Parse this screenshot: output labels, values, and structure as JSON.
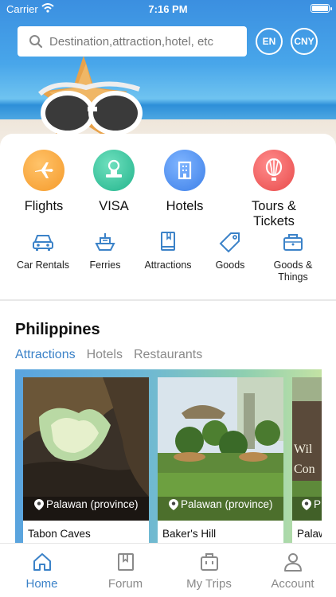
{
  "status_bar": {
    "carrier": "Carrier",
    "time": "7:16 PM"
  },
  "search": {
    "placeholder": "Destination,attraction,hotel, etc"
  },
  "header_buttons": {
    "language": "EN",
    "currency": "CNY"
  },
  "main_categories": [
    {
      "label": "Flights",
      "icon": "airplane-icon",
      "color": "#f7a43a"
    },
    {
      "label": "VISA",
      "icon": "visa-stamp-icon",
      "color": "#3cc3a0"
    },
    {
      "label": "Hotels",
      "icon": "building-icon",
      "color": "#4a8ff0"
    },
    {
      "label": "Tours & Tickets",
      "icon": "balloon-icon",
      "color": "#f05d5d"
    }
  ],
  "sub_categories": [
    {
      "label": "Car Rentals",
      "icon": "car-icon"
    },
    {
      "label": "Ferries",
      "icon": "ship-icon"
    },
    {
      "label": "Attractions",
      "icon": "book-icon"
    },
    {
      "label": "Goods",
      "icon": "tag-icon"
    },
    {
      "label": "Goods & Things",
      "icon": "basket-icon"
    }
  ],
  "region": {
    "title": "Philippines",
    "tabs": [
      "Attractions",
      "Hotels",
      "Restaurants"
    ],
    "active_tab": "Attractions"
  },
  "places": [
    {
      "name": "Tabon Caves",
      "location": "Palawan (province)"
    },
    {
      "name": "Baker's Hill",
      "location": "Palawan (province)"
    },
    {
      "name": "Palaw",
      "location": "P"
    }
  ],
  "tab_bar": [
    {
      "label": "Home",
      "icon": "home-icon",
      "active": true
    },
    {
      "label": "Forum",
      "icon": "forum-icon",
      "active": false
    },
    {
      "label": "My Trips",
      "icon": "briefcase-icon",
      "active": false
    },
    {
      "label": "Account",
      "icon": "person-icon",
      "active": false
    }
  ],
  "colors": {
    "accent": "#3b82c8",
    "header_blue": "#3b8fe0"
  }
}
